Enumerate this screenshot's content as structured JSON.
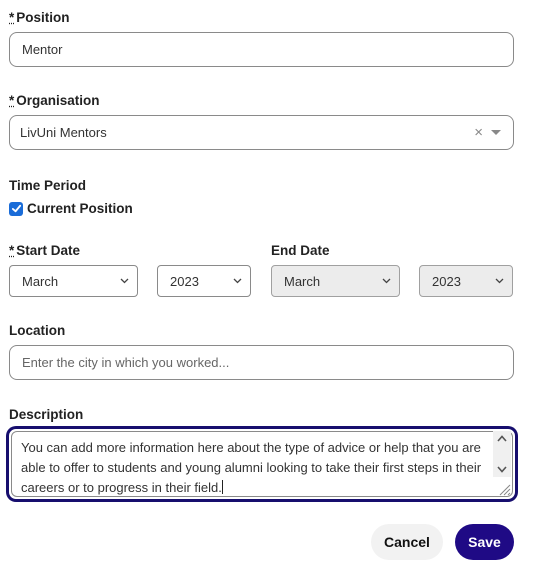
{
  "position": {
    "required_marker": "*",
    "label": "Position",
    "value": "Mentor"
  },
  "organisation": {
    "required_marker": "*",
    "label": "Organisation",
    "value": "LivUni Mentors",
    "clear_icon": "×"
  },
  "time_period": {
    "label": "Time Period",
    "current_position": {
      "label": "Current Position",
      "checked": true
    }
  },
  "start_date": {
    "required_marker": "*",
    "label": "Start Date",
    "month": "March",
    "year": "2023"
  },
  "end_date": {
    "label": "End Date",
    "month": "March",
    "year": "2023",
    "disabled": true
  },
  "location": {
    "label": "Location",
    "placeholder": "Enter the city in which you worked..."
  },
  "description": {
    "label": "Description",
    "value": "You can add more information here about the type of advice or help that you are able to offer to students and young alumni looking to take their first steps in their careers or to progress in their field."
  },
  "actions": {
    "cancel_label": "Cancel",
    "save_label": "Save"
  },
  "colors": {
    "primary": "#1f0a85",
    "focus_border": "#170e6e",
    "checkbox": "#1a6cd8"
  }
}
